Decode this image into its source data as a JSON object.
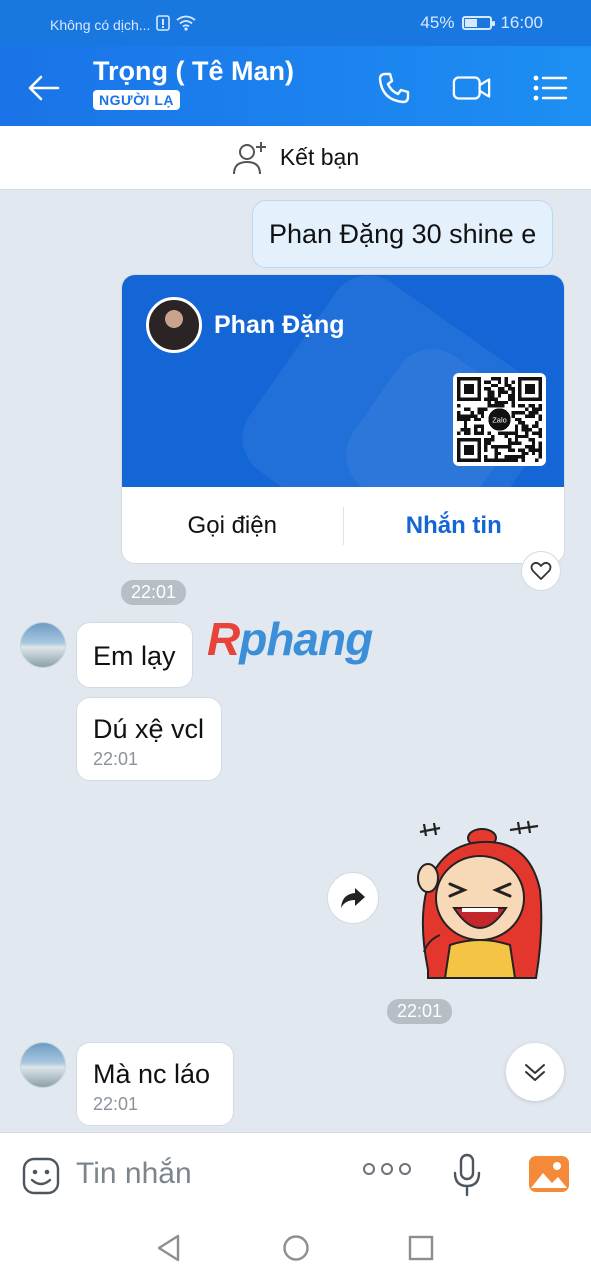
{
  "status_bar": {
    "carrier": "Không có dịch...",
    "battery": "45%",
    "battery_level": 0.45,
    "time": "16:00"
  },
  "header": {
    "title": "Trọng ( Tê Man)",
    "tag": "NGƯỜI LẠ"
  },
  "add_friend": {
    "label": "Kết bạn"
  },
  "messages": [
    {
      "text": "Phan Đặng 30 shine e"
    },
    {
      "text": "Em lạy"
    },
    {
      "text": "Dú xệ vcl",
      "time": "22:01"
    },
    {
      "text": "Mà nc láo",
      "time": "22:01"
    }
  ],
  "contact_card": {
    "name": "Phan Đặng",
    "qr_label": "Zalo",
    "call_label": "Gọi điện",
    "message_label": "Nhắn tin",
    "time": "22:01"
  },
  "watermark": {
    "first": "R",
    "rest": "phang"
  },
  "sticker_time": "22:01",
  "composer": {
    "placeholder": "Tin nhắn"
  },
  "colors": {
    "brand": "#1a73e8",
    "chat_bg": "#e2e8ef",
    "my_bubble": "#e4f1fd",
    "image_icon": "#f5893a"
  }
}
